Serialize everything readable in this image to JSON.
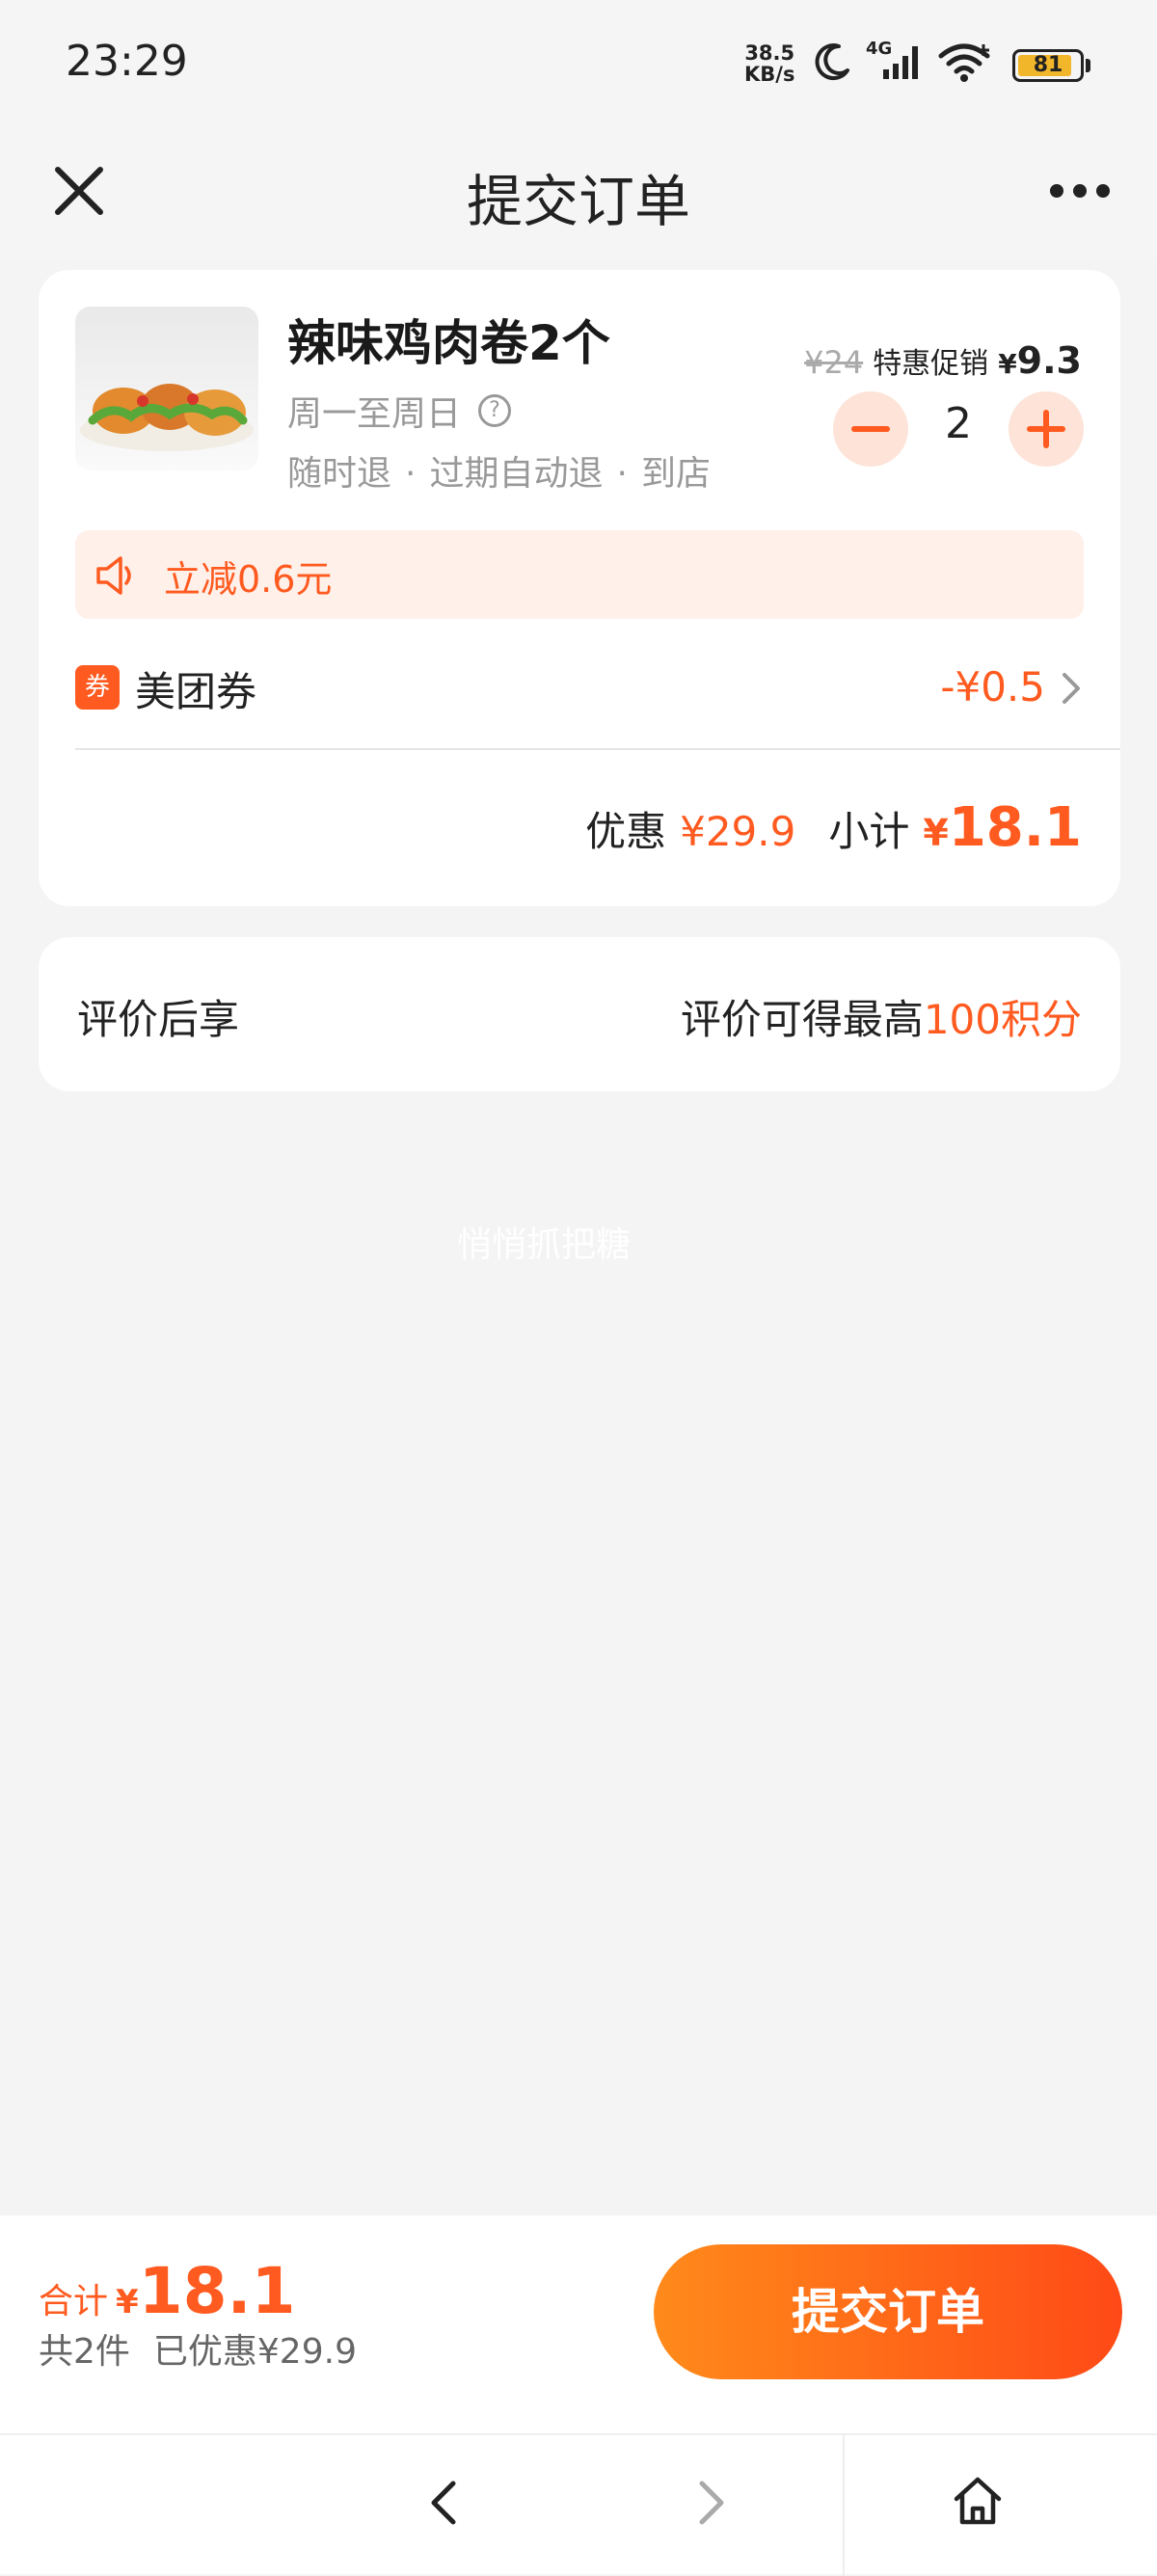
{
  "status_bar": {
    "time": "23:29",
    "net_speed_value": "38.5",
    "net_speed_unit": "KB/s",
    "network": "4G",
    "battery": "81",
    "icons": [
      "moon-icon",
      "signal-icon",
      "wifi-icon",
      "battery-icon"
    ]
  },
  "nav": {
    "title": "提交订单",
    "close_icon": "close-icon",
    "more_icon": "more-icon"
  },
  "product": {
    "name": "辣味鸡肉卷2个",
    "schedule": "周一至周日",
    "help_symbol": "?",
    "tags": [
      "随时退",
      "过期自动退",
      "到店"
    ],
    "tag_separator": "·",
    "original_price": "¥24",
    "promo_label": "特惠促销",
    "promo_currency": "¥",
    "promo_price": "9.3",
    "quantity": "2"
  },
  "discount_banner": {
    "text": "立减0.6元",
    "icon": "speaker-icon"
  },
  "coupon": {
    "badge": "券",
    "label": "美团券",
    "value": "-¥0.5"
  },
  "totals": {
    "discount_label": "优惠",
    "discount_value": "¥29.9",
    "subtotal_label": "小计",
    "subtotal_currency": "¥",
    "subtotal_value": "18.1"
  },
  "points": {
    "label": "评价后享",
    "value_prefix": "评价可得最高",
    "value_highlight": "100积分"
  },
  "watermark": "悄悄抓把糖",
  "bottom": {
    "total_label": "合计",
    "total_currency": "¥",
    "total_value": "18.1",
    "item_count": "共2件",
    "saved": "已优惠¥29.9",
    "submit_label": "提交订单"
  },
  "colors": {
    "accent": "#ff5a1f",
    "background": "#f4f4f4",
    "card": "#ffffff",
    "banner_bg": "#fff0ea"
  }
}
